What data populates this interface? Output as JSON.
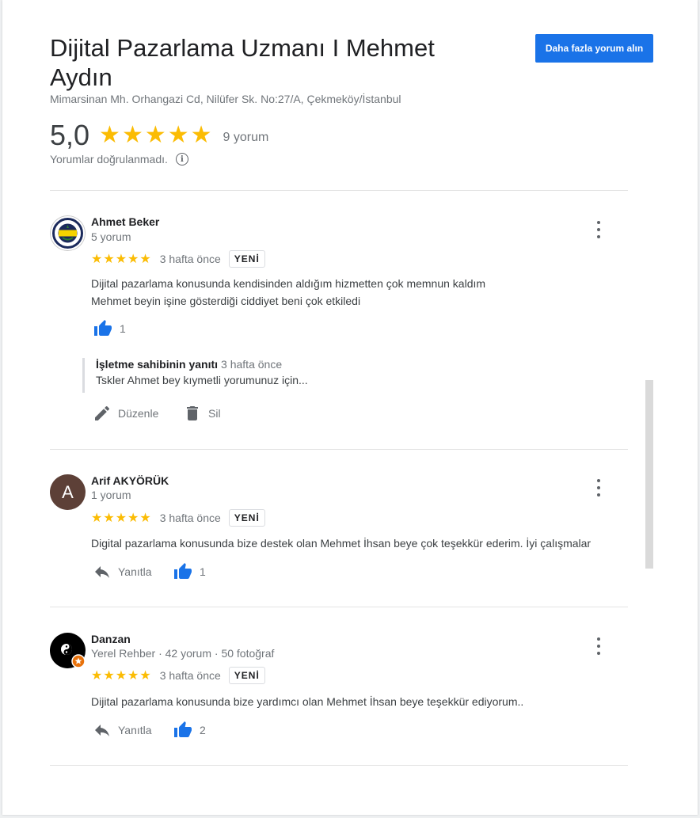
{
  "business": {
    "title": "Dijital Pazarlama Uzmanı I Mehmet Aydın",
    "address": "Mimarsinan Mh. Orhangazi Cd, Nilüfer Sk. No:27/A, Çekmeköy/İstanbul",
    "more_reviews_button": "Daha fazla yorum alın",
    "rating": "5,0",
    "stars": "★★★★★",
    "review_count": "9 yorum",
    "unverified_note": "Yorumlar doğrulanmadı.",
    "rating_value_numeric": 5.0
  },
  "reviews": [
    {
      "name": "Ahmet Beker",
      "meta": "5 yorum",
      "stars": "★★★★★",
      "rating": 5,
      "time": "3 hafta önce",
      "badge": "YENİ",
      "text_line1": "Dijital pazarlama konusunda  kendisinden aldığım hizmetten çok memnun kaldım",
      "text_line2": "Mehmet beyin işine gösterdiği ciddiyet beni çok etkiledi",
      "likes": "1",
      "owner_reply": {
        "title": "İşletme sahibinin yanıtı",
        "time": "3 hafta önce",
        "text": "Tskler Ahmet bey kıymetli yorumunuz için..."
      },
      "edit_label": "Düzenle",
      "delete_label": "Sil"
    },
    {
      "name": "Arif AKYÖRÜK",
      "meta": "1 yorum",
      "avatar_letter": "A",
      "avatar_color": "#5d4037",
      "stars": "★★★★★",
      "rating": 5,
      "time": "3 hafta önce",
      "badge": "YENİ",
      "text": "Digital pazarlama konusunda bize destek olan Mehmet İhsan beye çok teşekkür ederim. İyi çalışmalar",
      "reply_label": "Yanıtla",
      "likes": "1"
    },
    {
      "name": "Danzan",
      "meta": "Yerel Rehber · 42 yorum · 50 fotoğraf",
      "stars": "★★★★★",
      "rating": 5,
      "time": "3 hafta önce",
      "badge": "YENİ",
      "text": "Dijital pazarlama konusunda bize yardımcı olan Mehmet İhsan beye teşekkür ediyorum..",
      "reply_label": "Yanıtla",
      "likes": "2"
    }
  ],
  "colors": {
    "accent_blue": "#1a73e8",
    "star_yellow": "#fbbc04",
    "muted_text": "#70757a"
  }
}
